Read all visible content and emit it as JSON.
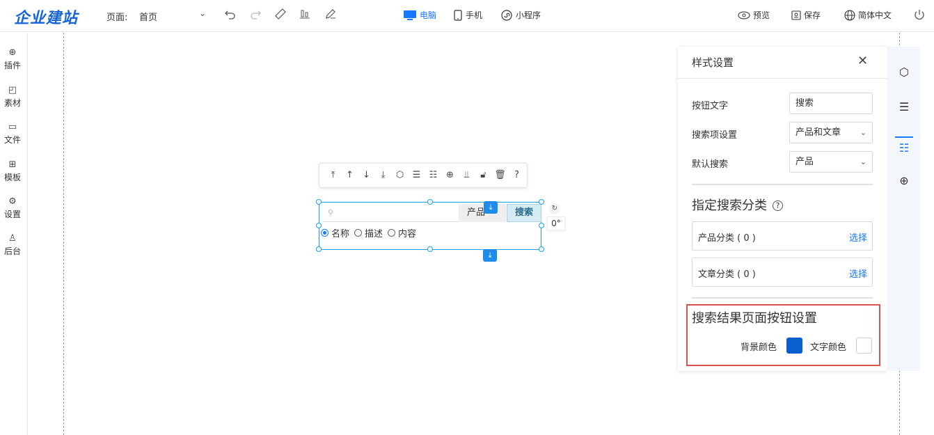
{
  "brand": {
    "logo_text": "企业建站",
    "color": "#1565d8"
  },
  "header": {
    "page_label": "页面:",
    "page_value": "首页",
    "devices": [
      {
        "label": "电脑",
        "active": true
      },
      {
        "label": "手机",
        "active": false
      },
      {
        "label": "小程序",
        "active": false
      }
    ],
    "actions": {
      "preview": "预览",
      "save": "保存",
      "language": "简体中文"
    }
  },
  "sidebar": {
    "items": [
      {
        "label": "插件",
        "icon": "plus-circle-icon"
      },
      {
        "label": "素材",
        "icon": "shapes-icon"
      },
      {
        "label": "文件",
        "icon": "folder-icon"
      },
      {
        "label": "模板",
        "icon": "grid-icon"
      },
      {
        "label": "设置",
        "icon": "gear-icon"
      },
      {
        "label": "后台",
        "icon": "user-icon"
      }
    ]
  },
  "widget": {
    "search_placeholder_icon": "search-icon",
    "select_value": "产品",
    "button_label": "搜索",
    "radios": [
      {
        "label": "名称",
        "checked": true
      },
      {
        "label": "描述",
        "checked": false
      },
      {
        "label": "内容",
        "checked": false
      }
    ],
    "angle": "0°"
  },
  "panel": {
    "title": "样式设置",
    "fields": [
      {
        "label": "按钮文字",
        "value": "搜索",
        "type": "input"
      },
      {
        "label": "搜索项设置",
        "value": "产品和文章",
        "type": "select"
      },
      {
        "label": "默认搜索",
        "value": "产品",
        "type": "select"
      }
    ],
    "category_section": {
      "title": "指定搜索分类",
      "items": [
        {
          "label": "产品分类 ( 0 )",
          "action": "选择"
        },
        {
          "label": "文章分类 ( 0 )",
          "action": "选择"
        }
      ]
    },
    "result_section": {
      "title": "搜索结果页面按钮设置",
      "bg_color_label": "背景颜色",
      "bg_color": "#0a5fd0",
      "text_color_label": "文字颜色",
      "text_color": "#ffffff"
    }
  },
  "colors": {
    "accent": "#1677ff",
    "highlight": "#d9534f"
  }
}
